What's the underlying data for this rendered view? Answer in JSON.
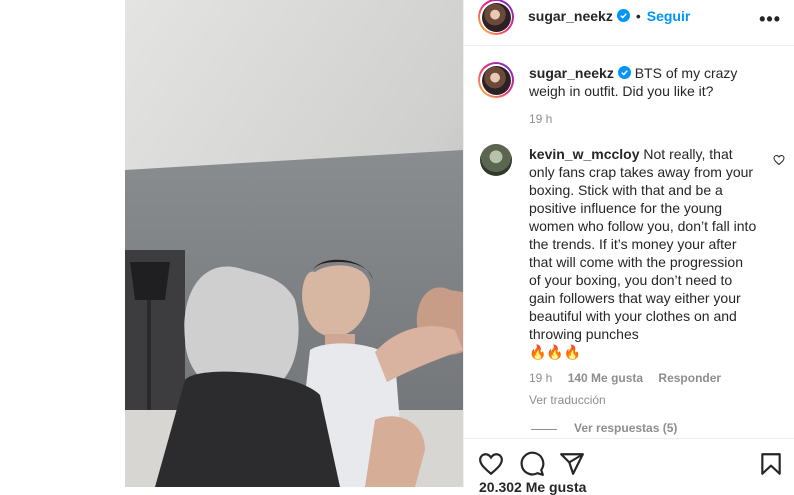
{
  "post": {
    "author": "sugar_neekz",
    "follow_label": "Seguir",
    "dot": "•",
    "more": "•••"
  },
  "caption": {
    "username": "sugar_neekz",
    "text": "BTS of my crazy weigh in outfit. Did you like it?",
    "time": "19 h"
  },
  "comment": {
    "username": "kevin_w_mccloy",
    "text": "Not really, that only fans crap takes away from your boxing. Stick with that and be a positive influence for the young women who follow you, don’t fall into the trends. If it’s money your after that will come with the progression of your boxing, you don’t need to gain followers that way either your beautiful with your clothes on and throwing punches",
    "emoji": "🔥🔥🔥",
    "time": "19 h",
    "likes": "140 Me gusta",
    "reply": "Responder",
    "translate": "Ver traducción",
    "view_replies": "Ver respuestas (5)"
  },
  "footer": {
    "likes_peek": "20.302 Me gusta"
  },
  "icons": [
    "verified-badge-icon",
    "more-options-icon",
    "heart-icon",
    "comment-icon",
    "share-icon",
    "save-icon"
  ],
  "colors": {
    "link": "#0095f6",
    "verified": "#0095f6",
    "muted": "#8e8e8e",
    "text": "#262626"
  }
}
